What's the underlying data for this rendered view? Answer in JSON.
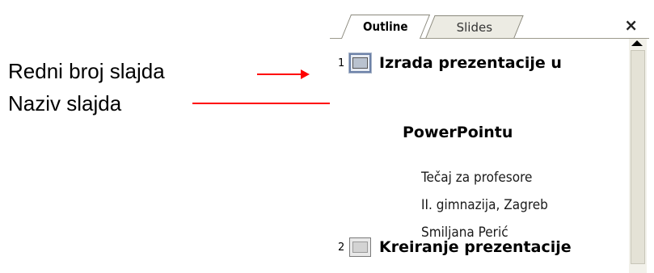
{
  "annotations": {
    "slide_number_label": "Redni broj slajda",
    "slide_name_label": "Naziv slajda",
    "arrow_color": "#ff0000"
  },
  "pane": {
    "tabs": [
      {
        "label": "Outline",
        "active": true
      },
      {
        "label": "Slides",
        "active": false
      }
    ],
    "close_symbol": "×"
  },
  "outline": {
    "slides": [
      {
        "number": "1",
        "title_line1": "Izrada prezentacije u",
        "title_line2": "PowerPointu",
        "body": [
          "Tečaj za  profesore",
          "II. gimnazija, Zagreb",
          "Smiljana Perić"
        ]
      },
      {
        "number": "2",
        "title_line1": "Kreiranje prezentacije"
      }
    ]
  }
}
